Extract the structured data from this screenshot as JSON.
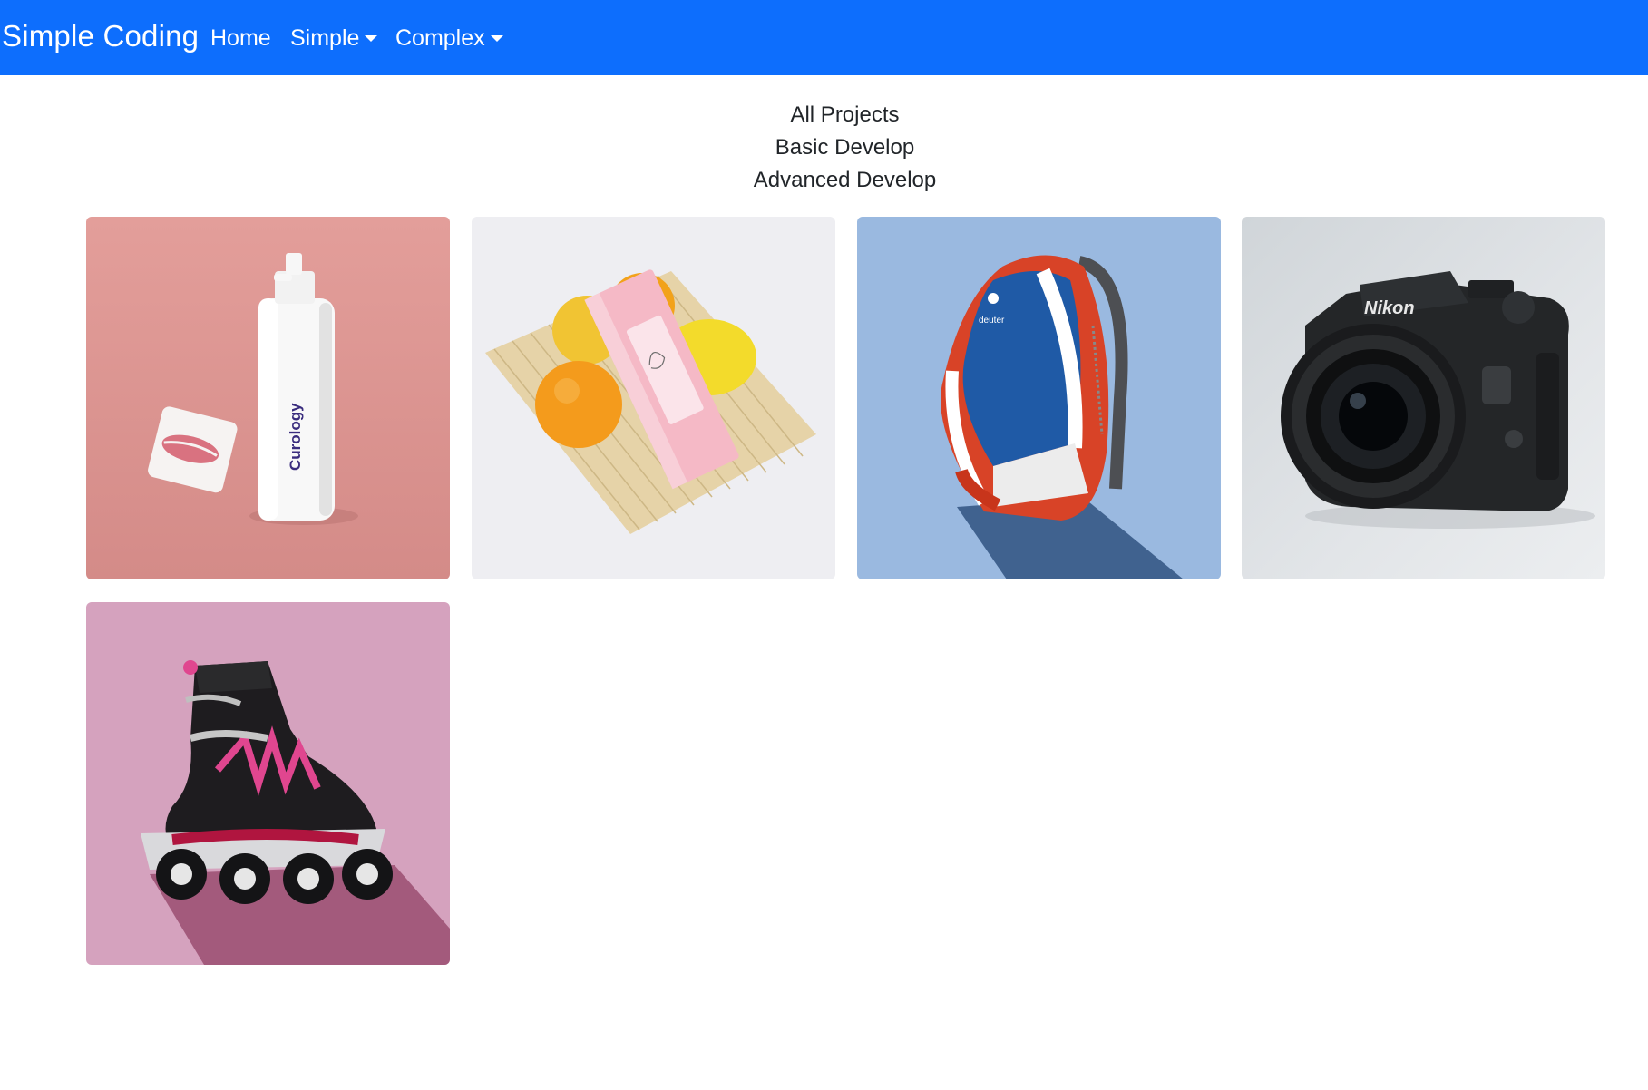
{
  "navbar": {
    "brand": "Simple Coding",
    "links": [
      {
        "label": "Home"
      },
      {
        "label": "Simple"
      },
      {
        "label": "Complex"
      }
    ],
    "background": "#0d6efd"
  },
  "filters": [
    {
      "label": "All Projects"
    },
    {
      "label": "Basic Develop"
    },
    {
      "label": "Advanced Develop"
    }
  ],
  "gallery": {
    "items": [
      {
        "subject": "skincare bottle with lips print",
        "product_text": "Curology",
        "background": "#e29c98"
      },
      {
        "subject": "pink box with oranges and lemon on bamboo mat",
        "background": "#eeeef2"
      },
      {
        "subject": "deuter backpack",
        "brand_text": "deuter",
        "background": "#9ab9e0"
      },
      {
        "subject": "Nikon D750 camera",
        "brand_text": "Nikon",
        "background": "#d4d8db"
      },
      {
        "subject": "inline skate",
        "background": "#d5a2be"
      }
    ]
  }
}
